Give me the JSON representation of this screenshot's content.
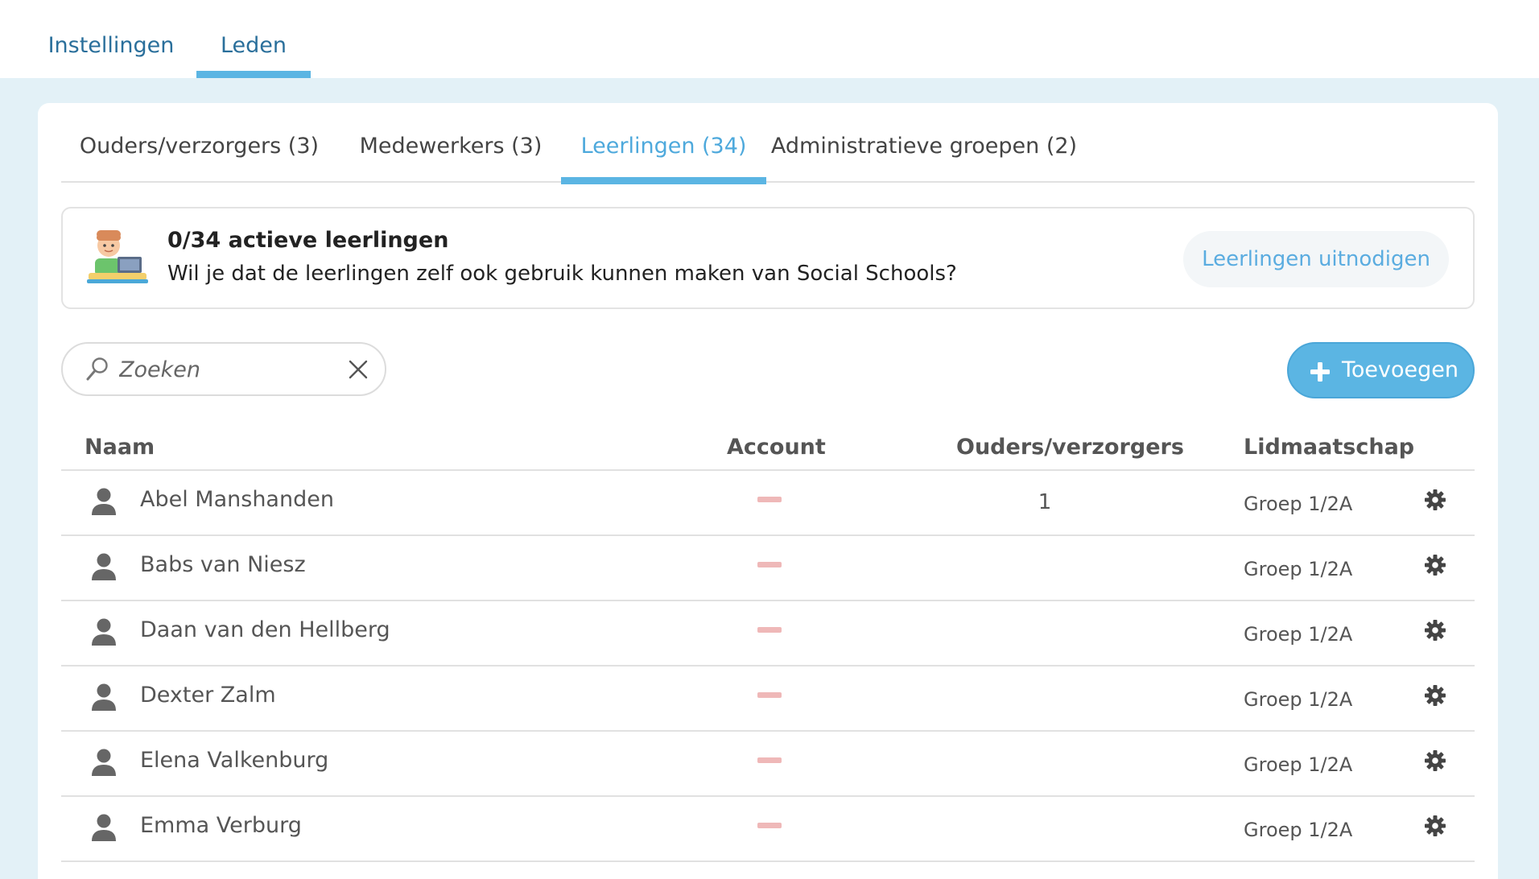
{
  "top_tabs": [
    {
      "label": "Instellingen",
      "active": false
    },
    {
      "label": "Leden",
      "active": true
    }
  ],
  "sub_tabs": [
    {
      "label": "Ouders/verzorgers (3)",
      "active": false
    },
    {
      "label": "Medewerkers (3)",
      "active": false
    },
    {
      "label": "Leerlingen (34)",
      "active": true
    },
    {
      "label": "Administratieve groepen (2)",
      "active": false
    }
  ],
  "banner": {
    "title": "0/34 actieve leerlingen",
    "text": "Wil je dat de leerlingen zelf ook gebruik kunnen maken van Social Schools?",
    "button_label": "Leerlingen uitnodigen"
  },
  "search": {
    "placeholder": "Zoeken",
    "value": ""
  },
  "add_button_label": "Toevoegen",
  "table": {
    "headers": {
      "name": "Naam",
      "account": "Account",
      "parents": "Ouders/verzorgers",
      "membership": "Lidmaatschap"
    },
    "rows": [
      {
        "name": "Abel Manshanden",
        "parents": "1",
        "group": "Groep 1/2A"
      },
      {
        "name": "Babs van Niesz",
        "parents": "",
        "group": "Groep 1/2A"
      },
      {
        "name": "Daan van den Hellberg",
        "parents": "",
        "group": "Groep 1/2A"
      },
      {
        "name": "Dexter Zalm",
        "parents": "",
        "group": "Groep 1/2A"
      },
      {
        "name": "Elena Valkenburg",
        "parents": "",
        "group": "Groep 1/2A"
      },
      {
        "name": "Emma Verburg",
        "parents": "",
        "group": "Groep 1/2A"
      }
    ]
  },
  "colors": {
    "accent": "#5bb5e3",
    "link": "#2a6f9b",
    "background": "#e3f1f7",
    "no_account_marker": "#efb8b8"
  },
  "icons": {
    "search": "search-icon",
    "clear": "close-icon",
    "add": "plus-icon",
    "avatar": "user-icon",
    "row_action": "gear-icon"
  }
}
